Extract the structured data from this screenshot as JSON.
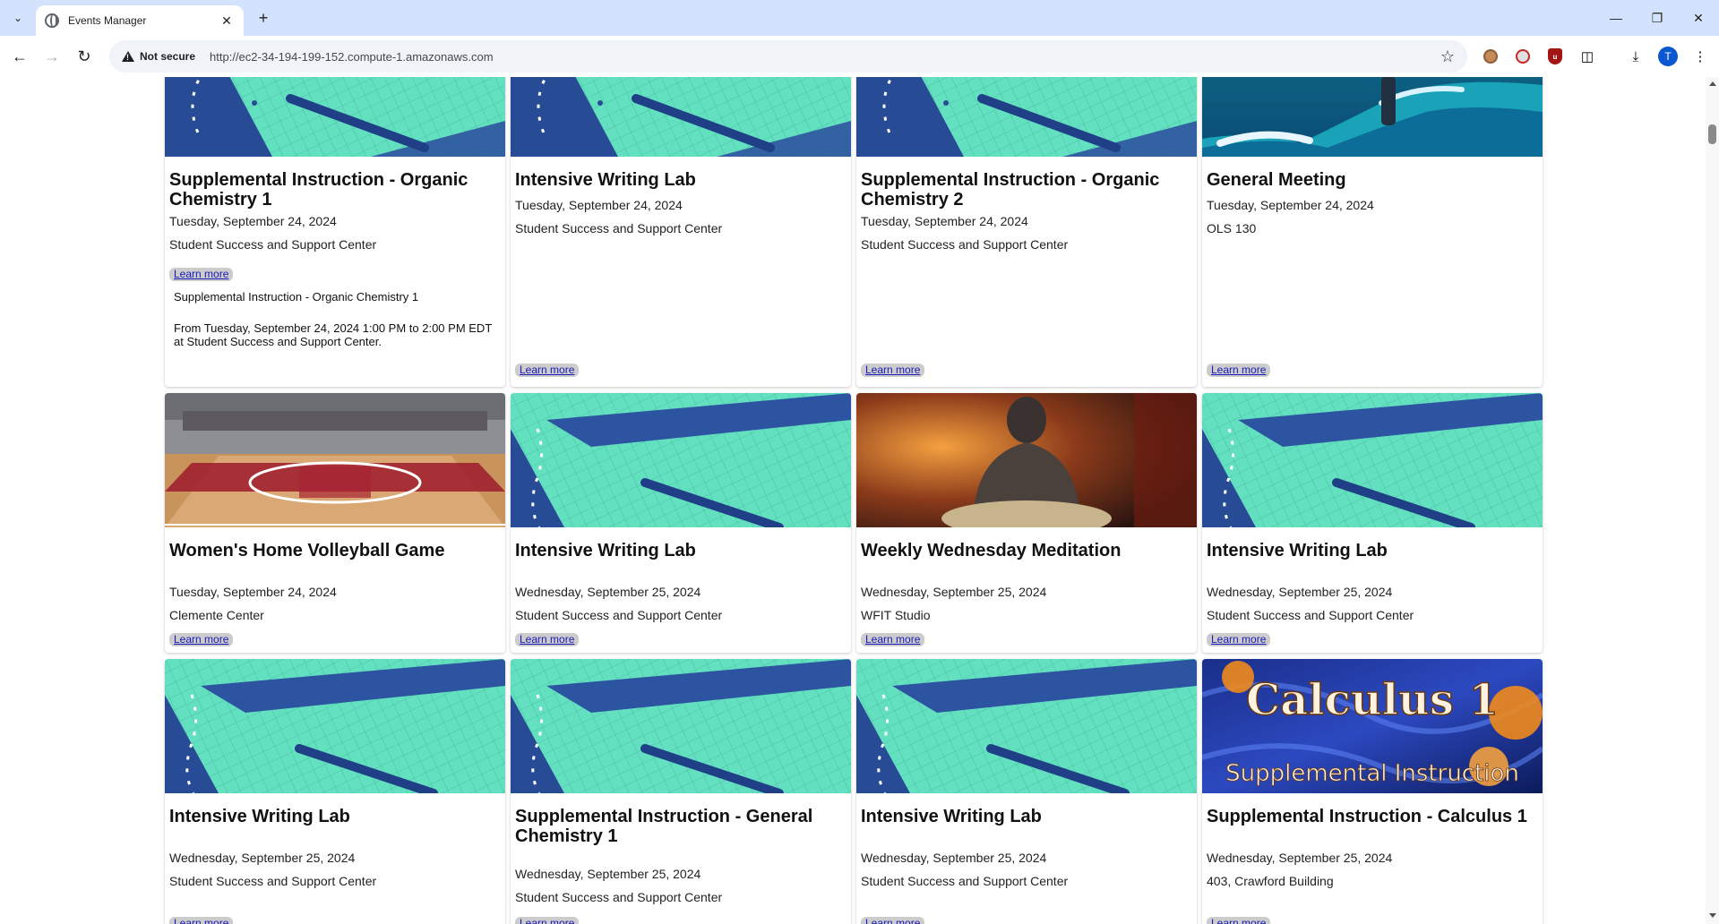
{
  "browser": {
    "tab_title": "Events Manager",
    "security_label": "Not secure",
    "url": "http://ec2-34-194-199-152.compute-1.amazonaws.com",
    "profile_initial": "T"
  },
  "events": [
    {
      "title": "Supplemental Instruction - Organic Chemistry 1",
      "date": "Tuesday, September 24, 2024",
      "location": "Student Success and Support Center",
      "link": "Learn more",
      "details": {
        "name": "Supplemental Instruction - Organic Chemistry 1",
        "time": "From Tuesday, September 24, 2024 1:00 PM to 2:00 PM EDT at Student Success and Support Center."
      }
    },
    {
      "title": "Intensive Writing Lab",
      "date": "Tuesday, September 24, 2024",
      "location": "Student Success and Support Center",
      "link": "Learn more"
    },
    {
      "title": "Supplemental Instruction - Organic Chemistry 2",
      "date": "Tuesday, September 24, 2024",
      "location": "Student Success and Support Center",
      "link": "Learn more"
    },
    {
      "title": "General Meeting",
      "date": "Tuesday, September 24, 2024",
      "location": "OLS 130",
      "link": "Learn more"
    },
    {
      "title": "Women's Home Volleyball Game",
      "date": "Tuesday, September 24, 2024",
      "location": "Clemente Center",
      "link": "Learn more"
    },
    {
      "title": "Intensive Writing Lab",
      "date": "Wednesday, September 25, 2024",
      "location": "Student Success and Support Center",
      "link": "Learn more"
    },
    {
      "title": "Weekly Wednesday Meditation",
      "date": "Wednesday, September 25, 2024",
      "location": "WFIT Studio",
      "link": "Learn more"
    },
    {
      "title": "Intensive Writing Lab",
      "date": "Wednesday, September 25, 2024",
      "location": "Student Success and Support Center",
      "link": "Learn more"
    },
    {
      "title": "Intensive Writing Lab",
      "date": "Wednesday, September 25, 2024",
      "location": "Student Success and Support Center",
      "link": "Learn more"
    },
    {
      "title": "Supplemental Instruction - General Chemistry 1",
      "date": "Wednesday, September 25, 2024",
      "location": "Student Success and Support Center",
      "link": "Learn more"
    },
    {
      "title": "Intensive Writing Lab",
      "date": "Wednesday, September 25, 2024",
      "location": "Student Success and Support Center",
      "link": "Learn more"
    },
    {
      "title": "Supplemental Instruction - Calculus 1",
      "date": "Wednesday, September 25, 2024",
      "location": "403, Crawford Building",
      "link": "Learn more"
    }
  ],
  "calculus_banner": {
    "line1": "Calculus 1",
    "line2": "Supplemental Instruction"
  },
  "icons": {
    "tab_search": "chevron-down-icon",
    "close": "close-icon",
    "new_tab": "plus-icon",
    "back": "arrow-left-icon",
    "forward": "arrow-right-icon",
    "reload": "reload-icon",
    "bookmark": "star-icon",
    "downloads": "download-icon",
    "extensions": "puzzle-icon",
    "menu": "kebab-menu-icon"
  },
  "colors": {
    "tabstrip_bg": "#d3e3fd",
    "omnibox_bg": "#f0f4f9",
    "link_color": "#1a1ab8",
    "link_bg": "#cccccc",
    "notebook_teal": "#63e0c0",
    "notebook_blue": "#284b96"
  }
}
